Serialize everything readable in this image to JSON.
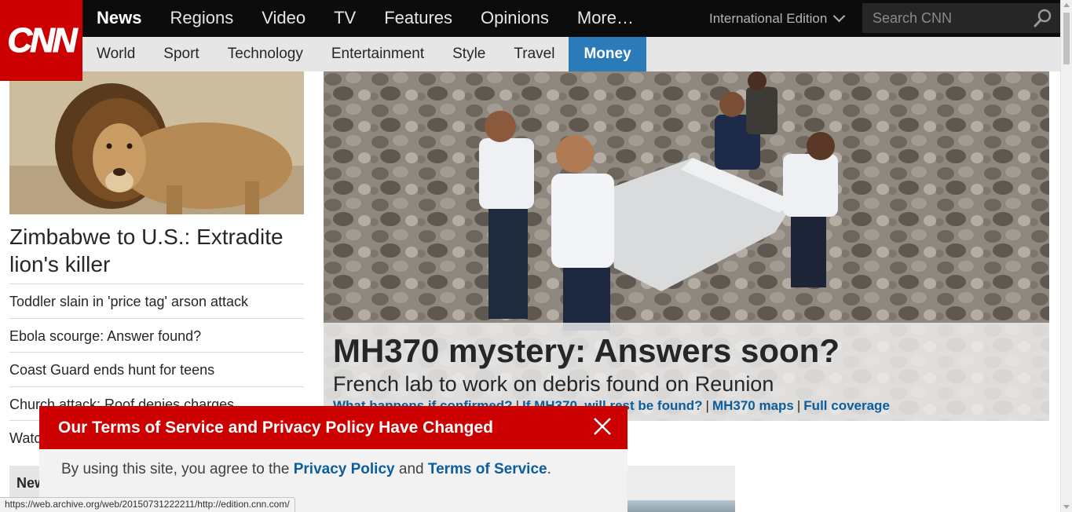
{
  "logo": {
    "text": "CNN"
  },
  "topnav": {
    "items": [
      "News",
      "Regions",
      "Video",
      "TV",
      "Features",
      "Opinions",
      "More…"
    ],
    "edition": "International Edition",
    "search_placeholder": "Search CNN"
  },
  "subnav": {
    "items": [
      "World",
      "Sport",
      "Technology",
      "Entertainment",
      "Style",
      "Travel",
      "Money"
    ]
  },
  "left": {
    "lead_headline": "Zimbabwe to U.S.: Extradite lion's killer",
    "stories": [
      "Toddler slain in 'price tag' arson attack",
      "Ebola scourge: Answer found?",
      "Coast Guard ends hunt for teens",
      "Church attack: Roof denies charges",
      "Watch"
    ],
    "newsletter_label": "New"
  },
  "hero": {
    "title": "MH370 mystery: Answers soon?",
    "subtitle": "French lab to work on debris found on Reunion",
    "links": [
      "What happens if confirmed?",
      "If MH370, will rest be found?",
      "MH370 maps",
      "Full coverage"
    ],
    "link_separator": "|"
  },
  "terms": {
    "title": "Our Terms of Service and Privacy Policy Have Changed",
    "body_prefix": "By using this site, you agree to the ",
    "privacy_link": "Privacy Policy",
    "body_and": " and ",
    "terms_link": "Terms of Service",
    "body_suffix": "."
  },
  "statusbar": {
    "url": "https://web.archive.org/web/20150731222211/http://edition.cnn.com/"
  },
  "colors": {
    "brand_red": "#cc0000",
    "nav_black": "#0c0c0c",
    "subnav_grey": "#e6e6e6",
    "active_blue": "#2b7bb9",
    "link_blue": "#0c5d9c"
  },
  "icons": {
    "search": "search-icon",
    "close": "close-icon",
    "chevron": "chevron-down-icon"
  }
}
